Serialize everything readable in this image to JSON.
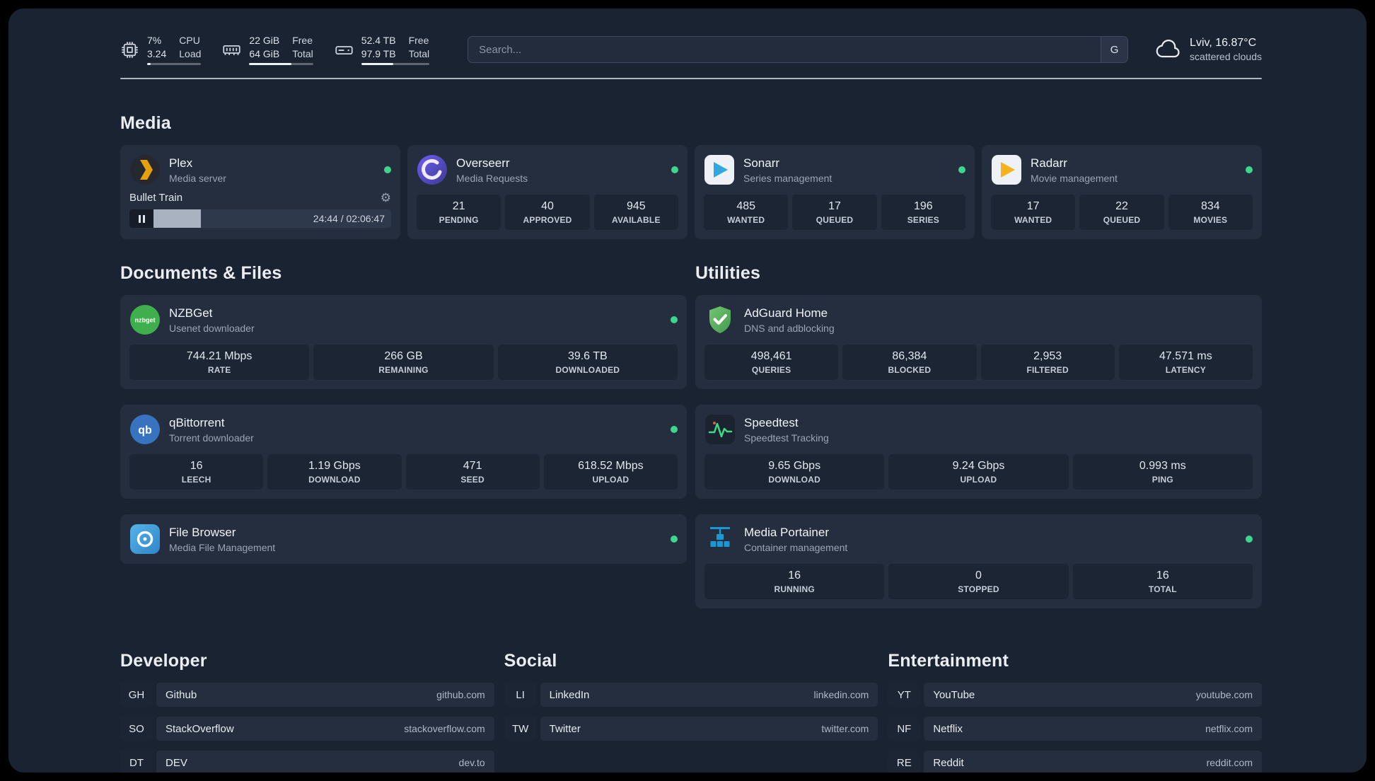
{
  "colors": {
    "status_online": "#3dd68c",
    "plex_gold": "#e5a00d",
    "panel_bg": "#1a2332"
  },
  "icons": {
    "gear": "⚙"
  },
  "topbar": {
    "cpu": {
      "value": "7%",
      "sub": "3.24",
      "label_top": "CPU",
      "label_bottom": "Load",
      "bar_percent": 7
    },
    "memory": {
      "value": "22 GiB",
      "sub": "64 GiB",
      "label_top": "Free",
      "label_bottom": "Total",
      "bar_percent": 66
    },
    "disk": {
      "value": "52.4 TB",
      "sub": "97.9 TB",
      "label_top": "Free",
      "label_bottom": "Total",
      "bar_percent": 47
    },
    "search": {
      "placeholder": "Search...",
      "provider_label": "G"
    },
    "weather": {
      "location": "Lviv, 16.87°C",
      "condition": "scattered clouds"
    }
  },
  "sections": {
    "media": {
      "title": "Media",
      "plex": {
        "name": "Plex",
        "desc": "Media server",
        "now_playing": "Bullet Train",
        "time": "24:44 / 02:06:47",
        "progress_percent": 20
      },
      "overseerr": {
        "name": "Overseerr",
        "desc": "Media Requests",
        "stats": [
          {
            "value": "21",
            "label": "PENDING"
          },
          {
            "value": "40",
            "label": "APPROVED"
          },
          {
            "value": "945",
            "label": "AVAILABLE"
          }
        ]
      },
      "sonarr": {
        "name": "Sonarr",
        "desc": "Series management",
        "stats": [
          {
            "value": "485",
            "label": "WANTED"
          },
          {
            "value": "17",
            "label": "QUEUED"
          },
          {
            "value": "196",
            "label": "SERIES"
          }
        ]
      },
      "radarr": {
        "name": "Radarr",
        "desc": "Movie management",
        "stats": [
          {
            "value": "17",
            "label": "WANTED"
          },
          {
            "value": "22",
            "label": "QUEUED"
          },
          {
            "value": "834",
            "label": "MOVIES"
          }
        ]
      }
    },
    "documents": {
      "title": "Documents & Files",
      "nzbget": {
        "name": "NZBGet",
        "desc": "Usenet downloader",
        "icon_text": "nzbget",
        "stats": [
          {
            "value": "744.21 Mbps",
            "label": "RATE"
          },
          {
            "value": "266 GB",
            "label": "REMAINING"
          },
          {
            "value": "39.6 TB",
            "label": "DOWNLOADED"
          }
        ]
      },
      "qbittorrent": {
        "name": "qBittorrent",
        "desc": "Torrent downloader",
        "icon_text": "qb",
        "stats": [
          {
            "value": "16",
            "label": "LEECH"
          },
          {
            "value": "1.19 Gbps",
            "label": "DOWNLOAD"
          },
          {
            "value": "471",
            "label": "SEED"
          },
          {
            "value": "618.52 Mbps",
            "label": "UPLOAD"
          }
        ]
      },
      "filebrowser": {
        "name": "File Browser",
        "desc": "Media File Management"
      }
    },
    "utilities": {
      "title": "Utilities",
      "adguard": {
        "name": "AdGuard Home",
        "desc": "DNS and adblocking",
        "stats": [
          {
            "value": "498,461",
            "label": "QUERIES"
          },
          {
            "value": "86,384",
            "label": "BLOCKED"
          },
          {
            "value": "2,953",
            "label": "FILTERED"
          },
          {
            "value": "47.571 ms",
            "label": "LATENCY"
          }
        ]
      },
      "speedtest": {
        "name": "Speedtest",
        "desc": "Speedtest Tracking",
        "stats": [
          {
            "value": "9.65 Gbps",
            "label": "DOWNLOAD"
          },
          {
            "value": "9.24 Gbps",
            "label": "UPLOAD"
          },
          {
            "value": "0.993 ms",
            "label": "PING"
          }
        ]
      },
      "portainer": {
        "name": "Media Portainer",
        "desc": "Container management",
        "stats": [
          {
            "value": "16",
            "label": "RUNNING"
          },
          {
            "value": "0",
            "label": "STOPPED"
          },
          {
            "value": "16",
            "label": "TOTAL"
          }
        ]
      }
    }
  },
  "bookmarks": {
    "developer": {
      "title": "Developer",
      "items": [
        {
          "abbr": "GH",
          "name": "Github",
          "domain": "github.com"
        },
        {
          "abbr": "SO",
          "name": "StackOverflow",
          "domain": "stackoverflow.com"
        },
        {
          "abbr": "DT",
          "name": "DEV",
          "domain": "dev.to"
        }
      ]
    },
    "social": {
      "title": "Social",
      "items": [
        {
          "abbr": "LI",
          "name": "LinkedIn",
          "domain": "linkedin.com"
        },
        {
          "abbr": "TW",
          "name": "Twitter",
          "domain": "twitter.com"
        }
      ]
    },
    "entertainment": {
      "title": "Entertainment",
      "items": [
        {
          "abbr": "YT",
          "name": "YouTube",
          "domain": "youtube.com"
        },
        {
          "abbr": "NF",
          "name": "Netflix",
          "domain": "netflix.com"
        },
        {
          "abbr": "RE",
          "name": "Reddit",
          "domain": "reddit.com"
        }
      ]
    }
  }
}
